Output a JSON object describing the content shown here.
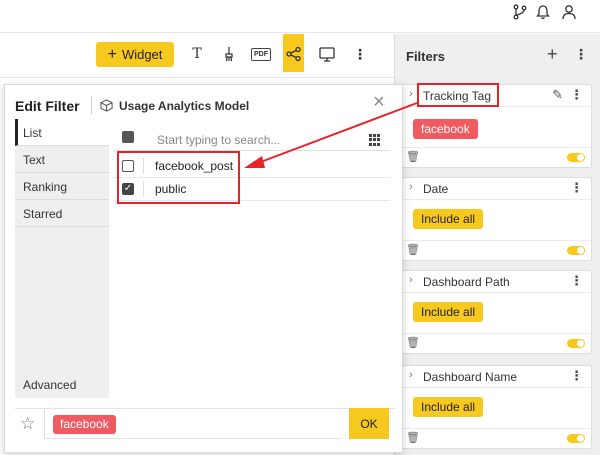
{
  "topbar": {
    "icons": [
      "branch-icon",
      "bell-icon",
      "user-icon"
    ]
  },
  "toolbar": {
    "widget_label": "Widget",
    "text_icon_glyph": "T",
    "pdf_label": "PDF"
  },
  "filters_panel": {
    "title": "Filters",
    "cards": [
      {
        "title": "Tracking Tag",
        "tag": "facebook",
        "tag_color": "#ef5b60"
      },
      {
        "title": "Date",
        "tag": "Include all",
        "tag_color": "#f7c81d"
      },
      {
        "title": "Dashboard Path",
        "tag": "Include all",
        "tag_color": "#f7c81d"
      },
      {
        "title": "Dashboard Name",
        "tag": "Include all",
        "tag_color": "#f7c81d"
      }
    ]
  },
  "dialog": {
    "title": "Edit Filter",
    "model": "Usage Analytics Model",
    "tabs": [
      "List",
      "Text",
      "Ranking",
      "Starred"
    ],
    "advanced_label": "Advanced",
    "search_placeholder": "Start typing to search...",
    "items": [
      {
        "label": "facebook_post",
        "checked": false
      },
      {
        "label": "public",
        "checked": true
      }
    ],
    "selected_tag": "facebook",
    "ok_label": "OK"
  },
  "colors": {
    "accent": "#f7c81d",
    "tag_red": "#ef5b60",
    "annotation": "#e3242b"
  }
}
